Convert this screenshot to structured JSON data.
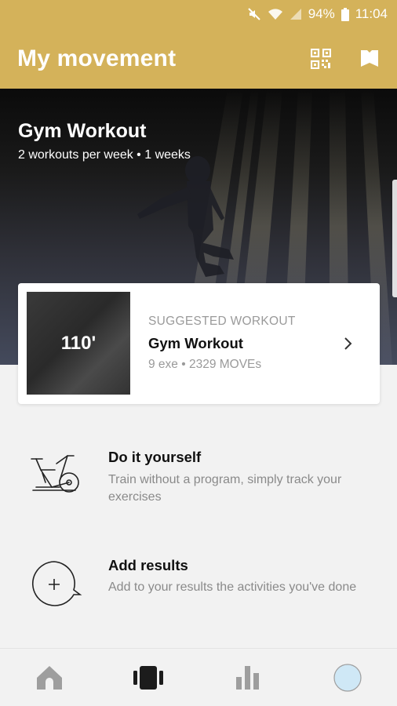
{
  "status_bar": {
    "battery": "94%",
    "time": "11:04",
    "icons": [
      "mute-icon",
      "wifi-icon",
      "signal-icon",
      "battery-icon"
    ]
  },
  "app_bar": {
    "title": "My movement",
    "actions": [
      "qr-code-icon",
      "bookmark-icon"
    ]
  },
  "hero": {
    "title": "Gym Workout",
    "subtitle": "2 workouts per week • 1 weeks"
  },
  "suggested": {
    "duration": "110'",
    "eyebrow": "SUGGESTED WORKOUT",
    "title": "Gym Workout",
    "meta": "9 exe • 2329 MOVEs"
  },
  "options": [
    {
      "title": "Do it yourself",
      "description": "Train without a program, simply track your exercises",
      "icon": "exercise-bike-icon"
    },
    {
      "title": "Add results",
      "description": "Add to your results the activities you've done",
      "icon": "add-results-icon"
    }
  ],
  "bottom_nav": {
    "items": [
      "home-icon",
      "workout-icon",
      "stats-icon",
      "profile-avatar"
    ],
    "active": "workout-icon"
  },
  "colors": {
    "accent": "#d4b25a",
    "background": "#f2f2f2",
    "nav_inactive": "#9e9e9e",
    "nav_active": "#1c1c1c",
    "avatar": "#cfe8f6"
  }
}
